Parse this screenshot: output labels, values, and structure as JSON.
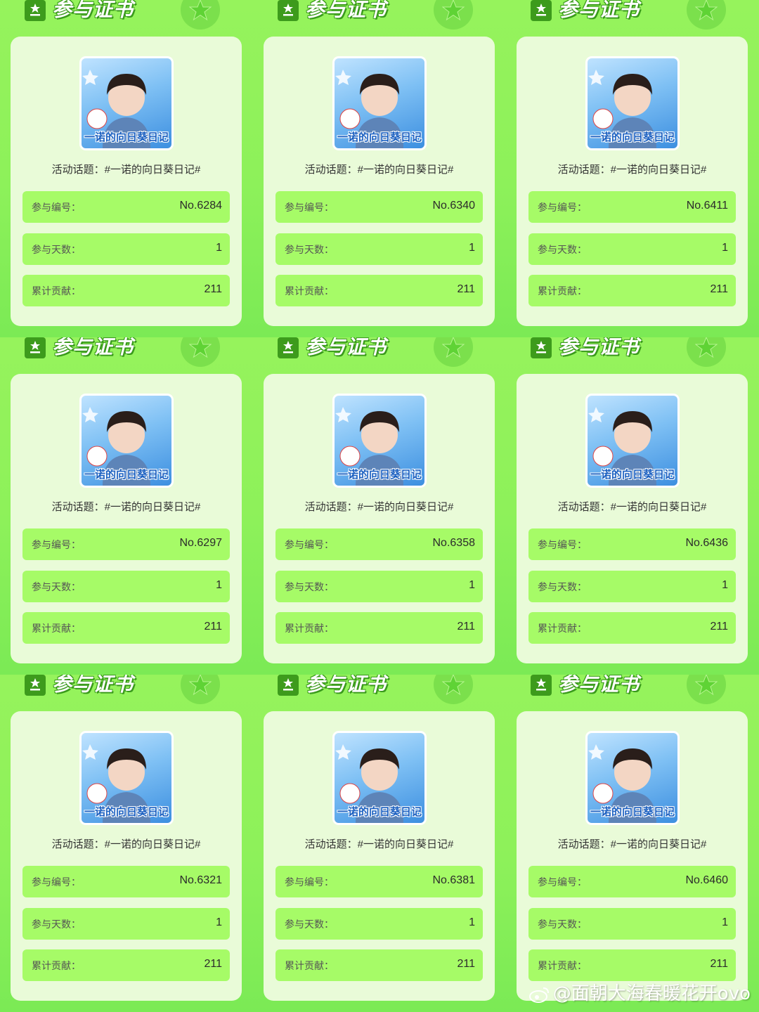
{
  "certificates": [
    {
      "title": "参与证书",
      "topic": "活动话题：#一诺的向日葵日记#",
      "avatar_caption": "一诺的向日葵日记",
      "id_label": "参与编号：",
      "id_value": "No.6284",
      "days_label": "参与天数：",
      "days_value": "1",
      "contrib_label": "累计贡献：",
      "contrib_value": "211"
    },
    {
      "title": "参与证书",
      "topic": "活动话题：#一诺的向日葵日记#",
      "avatar_caption": "一诺的向日葵日记",
      "id_label": "参与编号：",
      "id_value": "No.6340",
      "days_label": "参与天数：",
      "days_value": "1",
      "contrib_label": "累计贡献：",
      "contrib_value": "211"
    },
    {
      "title": "参与证书",
      "topic": "活动话题：#一诺的向日葵日记#",
      "avatar_caption": "一诺的向日葵日记",
      "id_label": "参与编号：",
      "id_value": "No.6411",
      "days_label": "参与天数：",
      "days_value": "1",
      "contrib_label": "累计贡献：",
      "contrib_value": "211"
    },
    {
      "title": "参与证书",
      "topic": "活动话题：#一诺的向日葵日记#",
      "avatar_caption": "一诺的向日葵日记",
      "id_label": "参与编号：",
      "id_value": "No.6297",
      "days_label": "参与天数：",
      "days_value": "1",
      "contrib_label": "累计贡献：",
      "contrib_value": "211"
    },
    {
      "title": "参与证书",
      "topic": "活动话题：#一诺的向日葵日记#",
      "avatar_caption": "一诺的向日葵日记",
      "id_label": "参与编号：",
      "id_value": "No.6358",
      "days_label": "参与天数：",
      "days_value": "1",
      "contrib_label": "累计贡献：",
      "contrib_value": "211"
    },
    {
      "title": "参与证书",
      "topic": "活动话题：#一诺的向日葵日记#",
      "avatar_caption": "一诺的向日葵日记",
      "id_label": "参与编号：",
      "id_value": "No.6436",
      "days_label": "参与天数：",
      "days_value": "1",
      "contrib_label": "累计贡献：",
      "contrib_value": "211"
    },
    {
      "title": "参与证书",
      "topic": "活动话题：#一诺的向日葵日记#",
      "avatar_caption": "一诺的向日葵日记",
      "id_label": "参与编号：",
      "id_value": "No.6321",
      "days_label": "参与天数：",
      "days_value": "1",
      "contrib_label": "累计贡献：",
      "contrib_value": "211"
    },
    {
      "title": "参与证书",
      "topic": "活动话题：#一诺的向日葵日记#",
      "avatar_caption": "一诺的向日葵日记",
      "id_label": "参与编号：",
      "id_value": "No.6381",
      "days_label": "参与天数：",
      "days_value": "1",
      "contrib_label": "累计贡献：",
      "contrib_value": "211"
    },
    {
      "title": "参与证书",
      "topic": "活动话题：#一诺的向日葵日记#",
      "avatar_caption": "一诺的向日葵日记",
      "id_label": "参与编号：",
      "id_value": "No.6460",
      "days_label": "参与天数：",
      "days_value": "1",
      "contrib_label": "累计贡献：",
      "contrib_value": "211"
    }
  ],
  "watermark": "@面朝大海春暖花开ovo",
  "icons": {
    "header": "certificate-icon",
    "badge": "star-icon",
    "watermark": "weibo-icon"
  },
  "colors": {
    "background": "#8df15a",
    "card": "#e9fbd8",
    "row": "#a6fb67",
    "accent": "#3d9b1c"
  }
}
